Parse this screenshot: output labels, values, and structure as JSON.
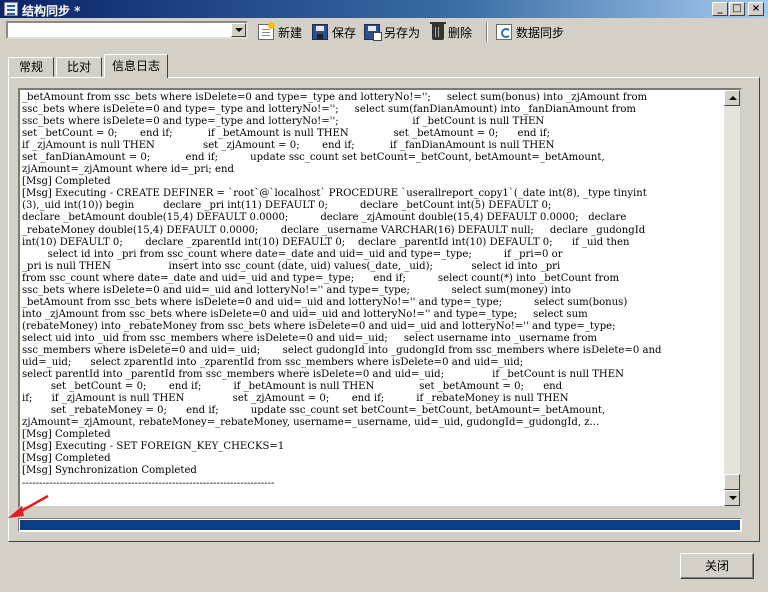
{
  "window": {
    "title": "结构同步 *",
    "controls": {
      "minimize": "_",
      "maximize": "□",
      "close": "×"
    }
  },
  "toolbar": {
    "connection_value": "",
    "new_label": "新建",
    "save_label": "保存",
    "saveas_label": "另存为",
    "delete_label": "删除",
    "sync_label": "数据同步"
  },
  "tabs": [
    {
      "label": "常规"
    },
    {
      "label": "比对"
    },
    {
      "label": "信息日志",
      "active": true
    }
  ],
  "log": {
    "lines": [
      "_betAmount from ssc_bets where isDelete=0 and type=_type and lotteryNo!='';     select sum(bonus) into _zjAmount from",
      "ssc_bets where isDelete=0 and type=_type and lotteryNo!='';     select sum(fanDianAmount) into _fanDianAmount from",
      "ssc_bets where isDelete=0 and type=_type and lotteryNo!='';                       if _betCount is null THEN",
      "set _betCount = 0;       end if;           if _betAmount is null THEN              set _betAmount = 0;      end if;",
      "if _zjAmount is null THEN               set _zjAmount = 0;       end if;           if _fanDianAmount is null THEN",
      "set _fanDianAmount = 0;           end if;          update ssc_count set betCount=_betCount, betAmount=_betAmount,",
      "zjAmount=_zjAmount where id=_pri; end",
      "[Msg] Completed",
      "[Msg] Executing - CREATE DEFINER = `root`@`localhost` PROCEDURE `userallreport_copy1`(_date int(8), _type tinyint",
      "(3),_uid int(10)) begin         declare _pri int(11) DEFAULT 0;          declare _betCount int(5) DEFAULT 0;",
      "declare _betAmount double(15,4) DEFAULT 0.0000;          declare _zjAmount double(15,4) DEFAULT 0.0000;   declare",
      "_rebateMoney double(15,4) DEFAULT 0.0000;       declare _username VARCHAR(16) DEFAULT null;     declare _gudongId",
      "int(10) DEFAULT 0;       declare _zparentId int(10) DEFAULT 0;    declare _parentId int(10) DEFAULT 0;      if _uid then",
      "        select id into _pri from ssc_count where date=_date and uid=_uid and type=_type;          if _pri=0 or",
      "_pri is null THEN                  insert into ssc_count (date, uid) values(_date, _uid);            select id into _pri",
      "from ssc_count where date=_date and uid=_uid and type=_type;      end if;          select count(*) into _betCount from",
      "ssc_bets where isDelete=0 and uid=_uid and lotteryNo!='' and type=_type;             select sum(money) into",
      "_betAmount from ssc_bets where isDelete=0 and uid=_uid and lotteryNo!='' and type=_type;          select sum(bonus)",
      "into _zjAmount from ssc_bets where isDelete=0 and uid=_uid and lotteryNo!='' and type=_type;     select sum",
      "(rebateMoney) into _rebateMoney from ssc_bets where isDelete=0 and uid=_uid and lotteryNo!='' and type=_type;",
      "select uid into _uid from ssc_members where isDelete=0 and uid=_uid;     select username into _username from",
      "ssc_members where isDelete=0 and uid=_uid;       select gudongId into _gudongId from ssc_members where isDelete=0 and",
      "uid=_uid;      select zparentId into _zparentId from ssc_members where isDelete=0 and uid=_uid;",
      "select parentId into _parentId from ssc_members where isDelete=0 and uid=_uid;               if _betCount is null THEN",
      "         set _betCount = 0;       end if;          if _betAmount is null THEN              set _betAmount = 0;      end",
      "if;      if _zjAmount is null THEN               set _zjAmount = 0;       end if;          if _rebateMoney is null THEN",
      "         set _rebateMoney = 0;      end if;          update ssc_count set betCount=_betCount, betAmount=_betAmount,",
      "zjAmount=_zjAmount, rebateMoney=_rebateMoney, username=_username, uid=_uid, gudongId=_gudongId, z...",
      "[Msg] Completed",
      "[Msg] Executing - SET FOREIGN_KEY_CHECKS=1",
      "[Msg] Completed",
      "[Msg] Synchronization Completed",
      "--------------------------------------------------------------------------"
    ]
  },
  "progress": {
    "value": 1.0
  },
  "footer": {
    "close_label": "关闭"
  },
  "colors": {
    "titlebar": "#0a246a",
    "progress": "#0b3d86",
    "annotation_arrow": "#e02020"
  }
}
